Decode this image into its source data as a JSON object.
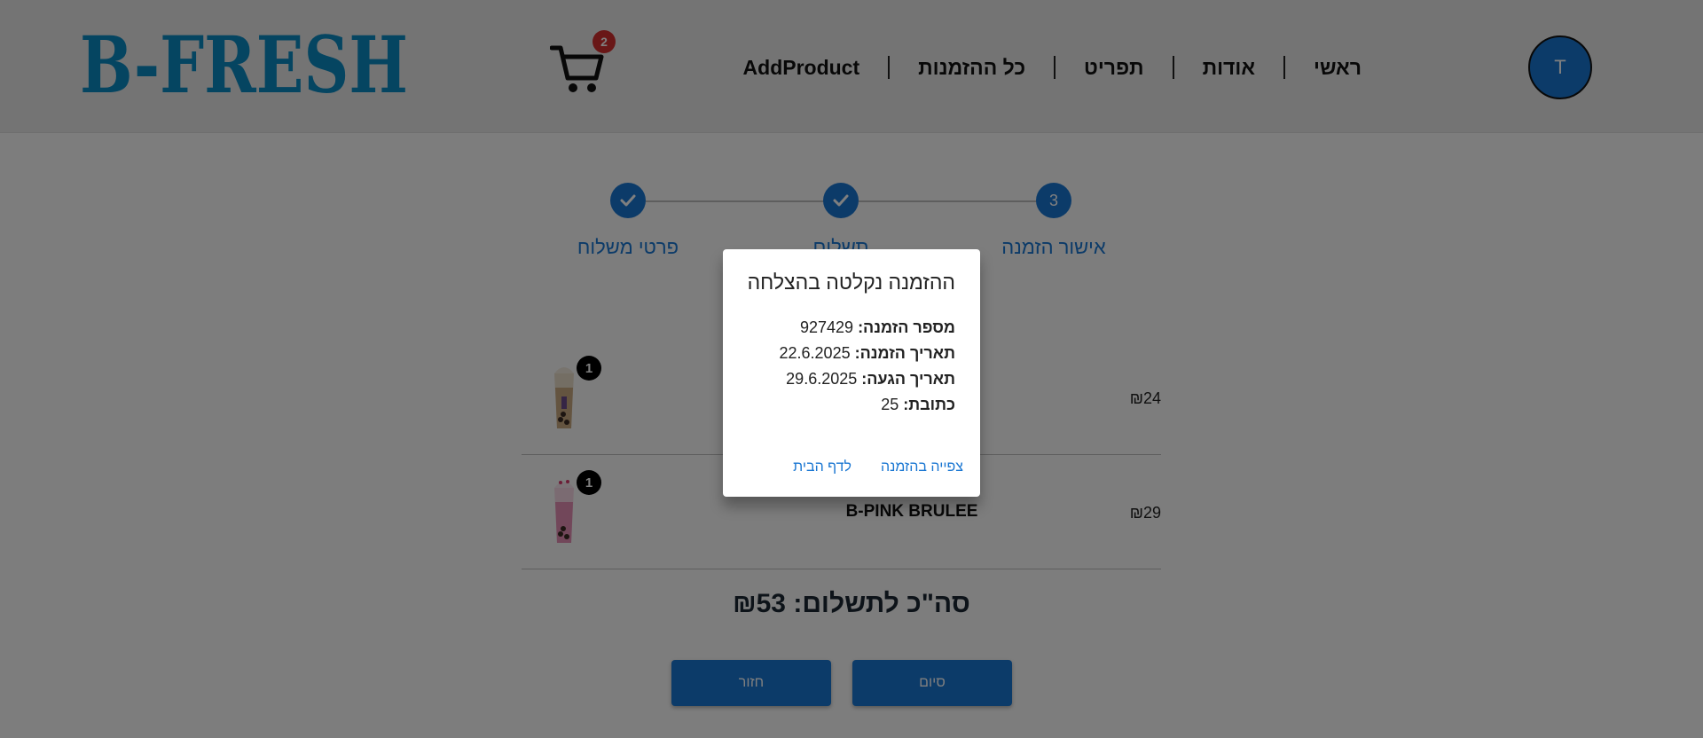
{
  "header": {
    "logo_text": "B-FRESH",
    "cart_count": "2",
    "nav": [
      "ראשי",
      "אודות",
      "תפריט",
      "כל ההזמנות",
      "AddProduct"
    ],
    "avatar_initial": "T"
  },
  "stepper": {
    "steps": [
      {
        "label": "פרטי משלוח",
        "state": "done",
        "icon": "check-icon"
      },
      {
        "label": "תשלום",
        "state": "done",
        "icon": "check-icon"
      },
      {
        "label": "אישור הזמנה",
        "state": "active",
        "number": "3"
      }
    ]
  },
  "cart": {
    "items": [
      {
        "name": "",
        "price": "₪24",
        "qty": "1"
      },
      {
        "name": "B-PINK BRULEE",
        "price": "₪29",
        "qty": "1"
      }
    ],
    "total": "סה\"כ לתשלום: ₪53"
  },
  "actions": {
    "finish": "סיום",
    "back": "חזור"
  },
  "dialog": {
    "title": "ההזמנה נקלטה בהצלחה",
    "order_number_label": "מספר הזמנה:",
    "order_number": "927429",
    "order_date_label": "תאריך הזמנה:",
    "order_date": "22.6.2025",
    "arrival_date_label": "תאריך הגעה:",
    "arrival_date": "29.6.2025",
    "address_label": "כתובת:",
    "address": "25",
    "view_order": "צפייה בהזמנה",
    "home": "לדף הבית"
  },
  "colors": {
    "accent": "#1976d2",
    "logo": "#0a8ac2",
    "badge": "#d32f2f"
  }
}
